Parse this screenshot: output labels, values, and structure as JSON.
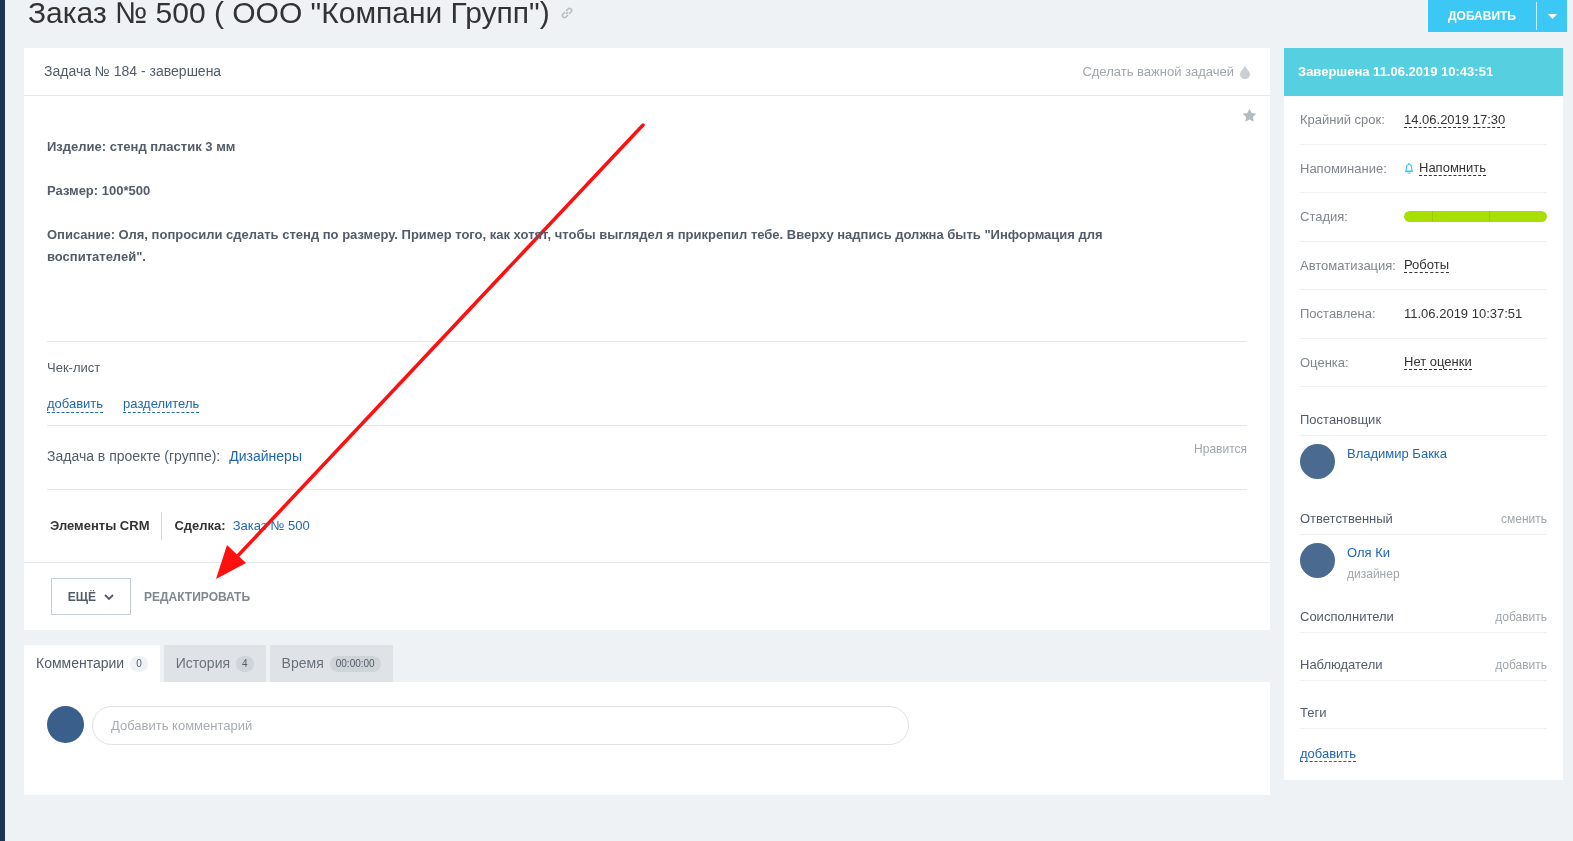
{
  "title": "Заказ № 500 ( ООО \"Компани Групп\")",
  "add_button": "ДОБАВИТЬ",
  "task": {
    "header": "Задача № 184 - завершена",
    "important_link": "Сделать важной задачей",
    "description": [
      "Изделие: стенд пластик 3 мм",
      "Размер: 100*500",
      "Описание: Оля, попросили сделать стенд по размеру. Пример того, как хотят, чтобы выглядел я прикрепил тебе. Вверху надпись должна быть \"Информация для воспитателей\"."
    ],
    "checklist": {
      "title": "Чек-лист",
      "actions": [
        "добавить",
        "разделитель"
      ]
    },
    "project": {
      "label": "Задача в проекте (группе):",
      "value": "Дизайнеры"
    },
    "like": "Нравится",
    "crm": {
      "title": "Элементы CRM",
      "label": "Сделка:",
      "value": "Заказ № 500"
    },
    "more_button": "ЕЩЁ",
    "edit_button": "РЕДАКТИРОВАТЬ"
  },
  "tabs": [
    {
      "label": "Комментарии",
      "count": "0",
      "selected": true
    },
    {
      "label": "История",
      "count": "4",
      "selected": false
    },
    {
      "label": "Время",
      "count": "00:00:00",
      "selected": false
    }
  ],
  "comment": {
    "placeholder": "Добавить комментарий"
  },
  "sidebar": {
    "status": "Завершена 11.06.2019 10:43:51",
    "fields": [
      {
        "kind": "link",
        "label": "Крайний срок:",
        "value": "14.06.2019 17:30"
      },
      {
        "kind": "reminder",
        "label": "Напоминание:",
        "value": "Напомнить"
      },
      {
        "kind": "stage",
        "label": "Стадия:",
        "level": 1
      },
      {
        "kind": "link",
        "label": "Автоматизация:",
        "value": "Роботы"
      },
      {
        "kind": "text",
        "label": "Поставлена:",
        "value": "11.06.2019 10:37:51"
      },
      {
        "kind": "link",
        "label": "Оценка:",
        "value": "Нет оценки"
      }
    ],
    "people": [
      {
        "title": "Постановщик",
        "name": "Владимир Бакка"
      },
      {
        "title": "Ответственный",
        "action": "сменить",
        "name": "Оля Ки",
        "role": "дизайнер"
      },
      {
        "title": "Соисполнители",
        "action": "добавить"
      },
      {
        "title": "Наблюдатели",
        "action": "добавить"
      },
      {
        "title": "Теги"
      }
    ],
    "tags_add": "добавить"
  }
}
